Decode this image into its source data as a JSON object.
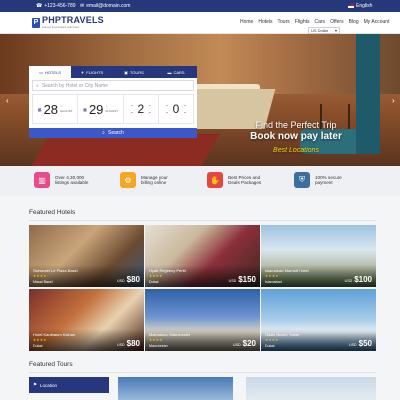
{
  "topbar": {
    "phone": "+123-456-789",
    "email": "email@domain.com",
    "language": "English"
  },
  "nav": {
    "logo_text": "PHPTRAVELS",
    "logo_sub": "travel business partner",
    "menu": [
      "Home",
      "Hotels",
      "Tours",
      "Flights",
      "Cars",
      "Offers",
      "Blog",
      "My Account"
    ],
    "currency": "US Dollar"
  },
  "hero": {
    "line1": "Find the Perfect Trip",
    "line2": "Book now pay later",
    "line3": "Best Locations"
  },
  "search": {
    "tabs": [
      "HOTELS",
      "FLIGHTS",
      "TOURS",
      "CARS"
    ],
    "placeholder": "Search by Hotel or City Name",
    "checkin_day": "28",
    "checkin_month": "AUGUST",
    "checkout_day": "29",
    "checkout_month": "AUGUST",
    "adults": "2",
    "children": "0",
    "button": "Search"
  },
  "features": [
    {
      "line1": "Over 4,30,000",
      "line2": "listings available",
      "color": "#e84b8a",
      "icon": "building-icon"
    },
    {
      "line1": "Manage your",
      "line2": "billing online",
      "color": "#f5a623",
      "icon": "billing-icon"
    },
    {
      "line1": "Best Prices and",
      "line2": "Deals Packages",
      "color": "#e5463f",
      "icon": "deals-icon"
    },
    {
      "line1": "100% secure",
      "line2": "payment",
      "color": "#3c6e9e",
      "icon": "shield-icon"
    }
  ],
  "featured_hotels_title": "Featured Hotels",
  "hotels": [
    {
      "name": "Swissotel Le Plaza Basel",
      "stars": "★★★★",
      "location": "Masai Basel",
      "currency": "USD",
      "price": "$80"
    },
    {
      "name": "Hyatt Regency Perth",
      "stars": "★★★★",
      "location": "Dubai",
      "currency": "USD",
      "price": "$150"
    },
    {
      "name": "Islamabad Marriott Hotel",
      "stars": "★★★★",
      "location": "Islamabad",
      "currency": "USD",
      "price": "$100"
    },
    {
      "name": "Hotel Kauthaum Kishan",
      "stars": "★★★★",
      "location": "Dubai",
      "currency": "USD",
      "price": "$80"
    },
    {
      "name": "Malmaison Manchester",
      "stars": "★★★★",
      "location": "Manchester",
      "currency": "USD",
      "price": "$20"
    },
    {
      "name": "Oasis Beach Tower",
      "stars": "★★★★",
      "location": "Dubai",
      "currency": "USD",
      "price": "$50"
    }
  ],
  "featured_tours_title": "Featured Tours",
  "tours_side_label": "Location"
}
